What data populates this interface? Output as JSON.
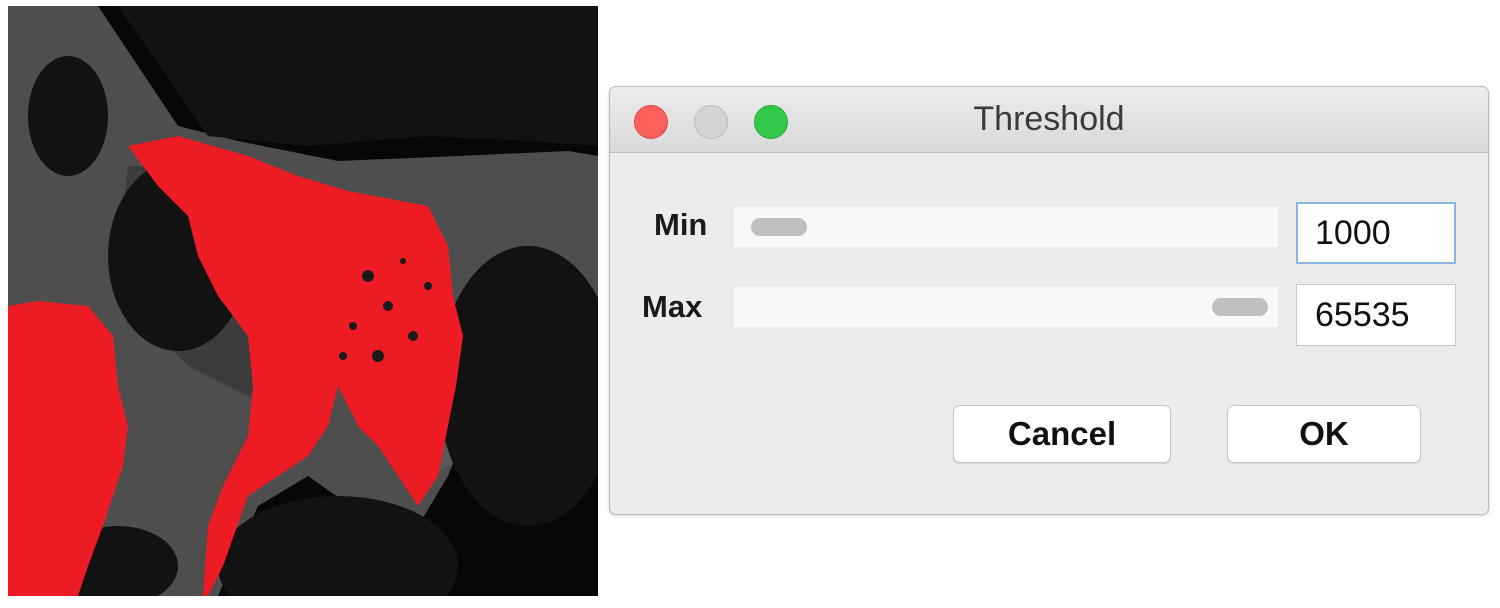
{
  "image": {
    "description_icon": "fluorescence-cell-image-with-red-threshold-overlay",
    "overlay_color": "#ed1c24",
    "background_color": "#070707"
  },
  "dialog": {
    "title": "Threshold",
    "min": {
      "label": "Min",
      "value": "1000",
      "slider_level": 0.0153
    },
    "max": {
      "label": "Max",
      "value": "65535",
      "slider_level": 1.0
    },
    "buttons": {
      "cancel_label": "Cancel",
      "ok_label": "OK"
    },
    "window_controls": [
      "close-icon",
      "minimize-icon",
      "zoom-icon"
    ]
  }
}
